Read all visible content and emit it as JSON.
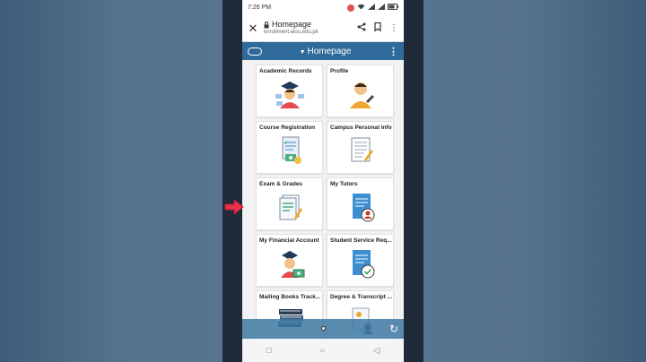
{
  "status_bar": {
    "time": "7:26 PM"
  },
  "browser": {
    "page_title": "Homepage",
    "domain": "enrollment.aiou.edu.pk"
  },
  "app_bar": {
    "title": "Homepage"
  },
  "tiles": [
    {
      "label": "Academic Records",
      "icon": "graduate-icon"
    },
    {
      "label": "Profile",
      "icon": "profile-person-icon"
    },
    {
      "label": "Course Registration",
      "icon": "registration-doc-icon"
    },
    {
      "label": "Campus Personal Info",
      "icon": "info-doc-icon"
    },
    {
      "label": "Exam & Grades",
      "icon": "exam-doc-icon"
    },
    {
      "label": "My Tutors",
      "icon": "tutor-doc-icon"
    },
    {
      "label": "My Financial Account",
      "icon": "graduate-money-icon"
    },
    {
      "label": "Student Service Req...",
      "icon": "service-doc-icon"
    },
    {
      "label": "Mailing Books Track...",
      "icon": "books-icon"
    },
    {
      "label": "Degree & Transcript ...",
      "icon": "degree-icon"
    }
  ],
  "colors": {
    "app_bar": "#2f6a9a",
    "arrow": "#e8344a"
  }
}
